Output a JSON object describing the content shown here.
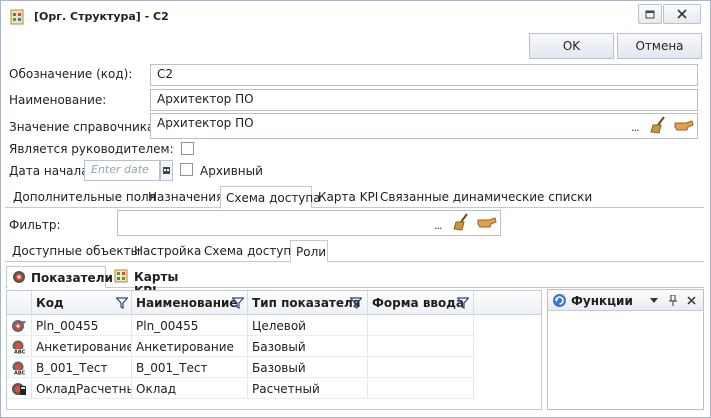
{
  "window": {
    "title": "[Орг. Структура] - С2",
    "icon": "org-structure-icon"
  },
  "toolbar": {
    "ok_label": "OK",
    "cancel_label": "Отмена"
  },
  "form": {
    "code_label": "Обозначение (код):",
    "code_value": "С2",
    "name_label": "Наименование:",
    "name_value": "Архитектор ПО",
    "ref_label": "Значение справочника:",
    "ref_value": "Архитектор ПО",
    "ref_dots": "...",
    "is_head_label": "Является руководителем:",
    "start_date_label": "Дата начала",
    "start_date_placeholder": "Enter date",
    "archive_label": "Архивный"
  },
  "tabs": [
    {
      "label": "Дополнительные поля"
    },
    {
      "label": "Назначения"
    },
    {
      "label": "Схема доступа"
    },
    {
      "label": "Карта KPI"
    },
    {
      "label": "Связанные динамические списки"
    }
  ],
  "active_tab": 2,
  "filter": {
    "label": "Фильтр:",
    "dots": "..."
  },
  "subtabs": [
    {
      "label": "Доступные объекты"
    },
    {
      "label": "Настройка"
    },
    {
      "label": "Схема доступа"
    },
    {
      "label": "Роли"
    }
  ],
  "active_subtab": 3,
  "inner_tabs": [
    {
      "label": "Показатели",
      "icon": "indicator-icon"
    },
    {
      "label": "Карты KPI",
      "icon": "kpi-map-icon"
    }
  ],
  "grid": {
    "columns": [
      "Код",
      "Наименование",
      "Тип показателя",
      "Форма ввода"
    ],
    "rows": [
      {
        "code": "Pln_00455",
        "name": "Pln_00455",
        "type": "Целевой",
        "form": "",
        "icon": "target-indicator-icon"
      },
      {
        "code": "Анкетирование",
        "name": "Анкетирование",
        "type": "Базовый",
        "form": "",
        "icon": "abc-indicator-icon"
      },
      {
        "code": "B_001_Тест",
        "name": "B_001_Тест",
        "type": "Базовый",
        "form": "",
        "icon": "abc-indicator-icon"
      },
      {
        "code": "ОкладРасчетный",
        "name": "Оклад",
        "type": "Расчетный",
        "form": "",
        "icon": "calc-indicator-icon"
      }
    ]
  },
  "functions_panel": {
    "title": "Функции"
  },
  "colors": {
    "border": "#b7c2cf",
    "accent": "#2f6fbf",
    "header_bg": "#eef1f4"
  }
}
